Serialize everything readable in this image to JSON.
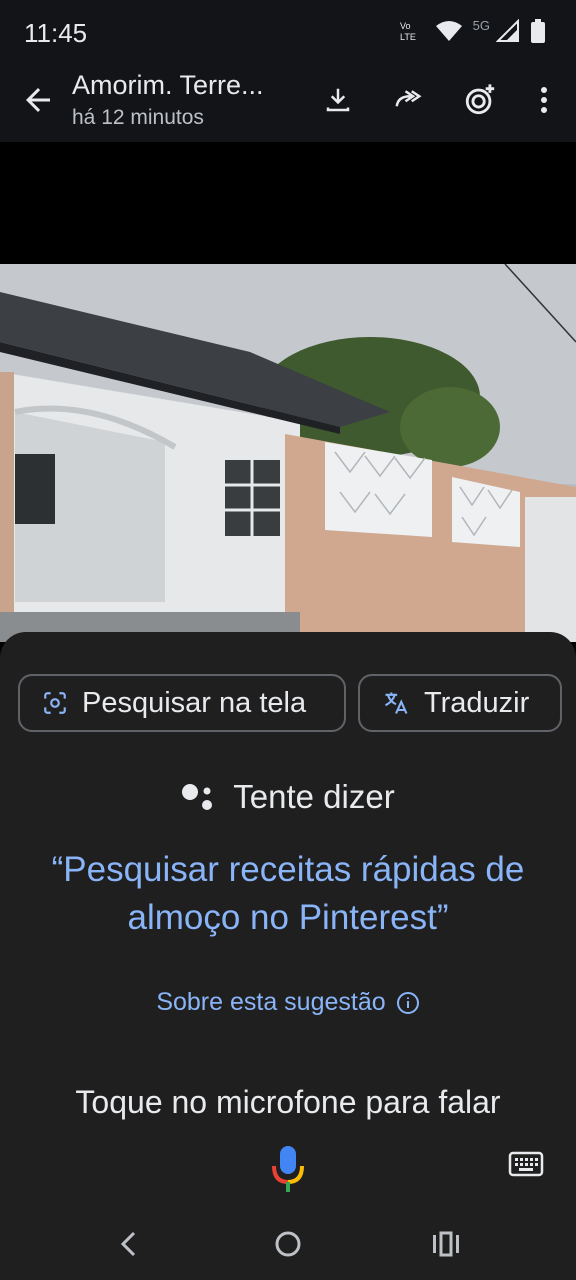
{
  "status": {
    "time": "11:45",
    "network": "5G"
  },
  "appbar": {
    "title": "Amorim.  Terre...",
    "subtitle": "há 12 minutos",
    "icons": [
      "back-arrow-icon",
      "download-icon",
      "forward-icon",
      "add-to-status-icon",
      "more-vert-icon"
    ]
  },
  "assistant": {
    "search_screen_label": "Pesquisar na tela",
    "translate_label": "Traduzir",
    "try_saying": "Tente dizer",
    "suggestion": "“Pesquisar receitas rápidas de almoço no Pinterest”",
    "about_suggestion": "Sobre esta sugestão",
    "tap_prompt": "Toque no microfone para falar"
  },
  "colors": {
    "sheet_bg": "#1f1f1f",
    "accent_blue": "#8ab4f8",
    "text_primary": "#e8eaed"
  }
}
